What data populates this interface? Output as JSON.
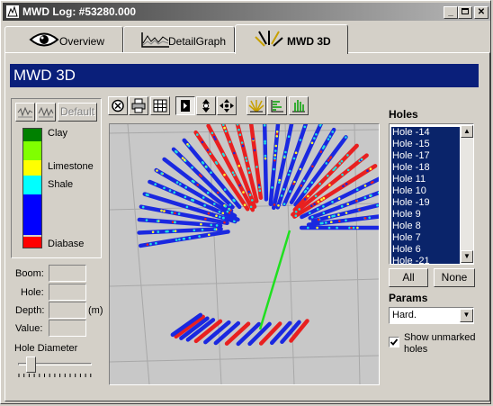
{
  "window": {
    "title": "MWD Log: #53280.000"
  },
  "tabs": [
    {
      "label": "Overview"
    },
    {
      "label": "DetailGraph"
    },
    {
      "label": "MWD 3D"
    }
  ],
  "header": {
    "title": "MWD 3D"
  },
  "left_panel": {
    "default_label": "Default",
    "legend": [
      {
        "label": "Clay",
        "color": "#008000"
      },
      {
        "label": "Limestone",
        "color": "#ffff00"
      },
      {
        "label": "Shale",
        "color": "#00ffff"
      },
      {
        "label": "Diabase",
        "color": "#ff0000"
      }
    ],
    "fields": [
      {
        "label": "Boom:",
        "value": ""
      },
      {
        "label": "Hole:",
        "value": ""
      },
      {
        "label": "Depth:",
        "value": ""
      },
      {
        "label": "Value:",
        "value": ""
      }
    ],
    "depth_unit": "(m)",
    "hole_diameter_label": "Hole Diameter",
    "hole_diameter_value": 0.15
  },
  "right_panel": {
    "holes_label": "Holes",
    "holes": [
      "Hole -14",
      "Hole -15",
      "Hole -17",
      "Hole -18",
      "Hole 11",
      "Hole 10",
      "Hole -19",
      "Hole 9",
      "Hole 8",
      "Hole 7",
      "Hole 6",
      "Hole -21"
    ],
    "all_label": "All",
    "none_label": "None",
    "params_label": "Params",
    "params_value": "Hard.",
    "show_unmarked_label": "Show unmarked holes",
    "show_unmarked_checked": true
  }
}
